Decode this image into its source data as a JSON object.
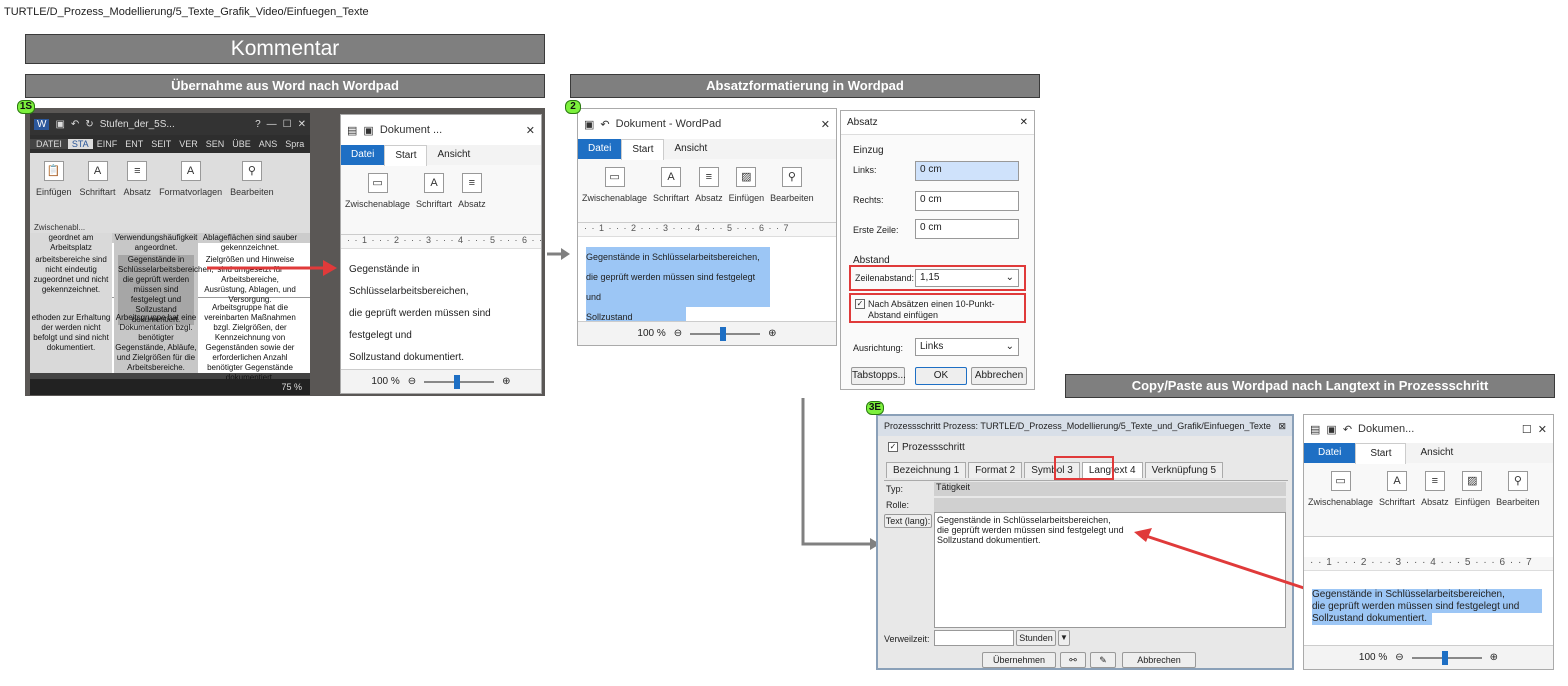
{
  "breadcrumb": "TURTLE/D_Prozess_Modellierung/5_Texte_Grafik_Video/Einfuegen_Texte",
  "headers": {
    "kommentar": "Kommentar",
    "step1": "Übernahme aus Word nach Wordpad",
    "step2": "Absatzformatierung in Wordpad",
    "step3": "Copy/Paste aus Wordpad nach Langtext in Prozessschritt"
  },
  "markers": {
    "m1": "1S",
    "m2": "2",
    "m3": "3E"
  },
  "word": {
    "title": "Stufen_der_5S...",
    "help": "?",
    "tabs": [
      "DATEI",
      "STA",
      "EINF",
      "ENT",
      "SEIT",
      "VER",
      "SEN",
      "ÜBE",
      "ANS",
      "Spra"
    ],
    "groups": [
      "Einfügen",
      "Schriftart",
      "Absatz",
      "Formatvorlagen",
      "Bearbeiten"
    ],
    "group_label": "Zwischenabl...",
    "cells": [
      "geordnet am Arbeitsplatz",
      "Verwendungshäufigkeit angeordnet.",
      "Ablageflächen sind sauber gekennzeichnet.",
      "arbeitsbereiche sind nicht eindeutig zugeordnet und nicht gekennzeichnet.",
      "Gegenstände in Schlüsselarbeitsbereichen, die geprüft werden müssen sind festgelegt und Sollzustand dokumentiert.",
      "Zielgrößen und Hinweise sind umgesetzt für Arbeitsbereiche, Ausrüstung, Ablagen, und Versorgung.",
      "ethoden zur Erhaltung der werden nicht befolgt und sind nicht dokumentiert.",
      "Arbeitsgruppe hat eine Dokumentation bzgl. benötigter Gegenstände, Abläufe, und Zielgrößen für die Arbeitsbereiche.",
      "Arbeitsgruppe hat die vereinbarten Maßnahmen bzgl. Zielgrößen, der Kennzeichnung von Gegenständen sowie der erforderlichen Anzahl benötigter Gegenstände dokumentiert."
    ],
    "zoom": "75 %"
  },
  "wordpad": {
    "title1": "Dokument ...",
    "title2": "Dokument - WordPad",
    "title3": "Dokumen...",
    "tabs": [
      "Datei",
      "Start",
      "Ansicht"
    ],
    "groups": [
      "Zwischenablage",
      "Schriftart",
      "Absatz",
      "Einfügen",
      "Bearbeiten"
    ],
    "ruler": "·  · 1 · · · 2 · · · 3 · · · 4 · · · 5 · · · 6 · · 7",
    "lines": [
      "Gegenstände in Schlüsselarbeitsbereichen,",
      "die geprüft werden müssen sind festgelegt und",
      "Sollzustand dokumentiert."
    ],
    "zoom": "100 %"
  },
  "absatz": {
    "title": "Absatz",
    "einzug": "Einzug",
    "links_label": "Links:",
    "links_value": "0 cm",
    "rechts_label": "Rechts:",
    "rechts_value": "0 cm",
    "erste_label": "Erste Zeile:",
    "erste_value": "0 cm",
    "abstand": "Abstand",
    "zeilen_label": "Zeilenabstand:",
    "zeilen_value": "1,15",
    "nach_label": "Nach Absätzen einen 10-Punkt-Abstand einfügen",
    "ausrichtung_label": "Ausrichtung:",
    "ausrichtung_value": "Links",
    "tabstopps": "Tabstopps...",
    "ok": "OK",
    "abbrechen": "Abbrechen"
  },
  "prozess": {
    "title": "Prozessschritt Prozess: TURTLE/D_Prozess_Modellierung/5_Texte_und_Grafik/Einfuegen_Texte",
    "checkbox": "Prozessschritt",
    "tabs": [
      "Bezeichnung 1",
      "Format 2",
      "Symbol 3",
      "Langtext 4",
      "Verknüpfung 5"
    ],
    "typ_label": "Typ:",
    "typ_value": "Tätigkeit",
    "rolle_label": "Rolle:",
    "text_label": "Text (lang):",
    "text_lines": [
      "Gegenstände in Schlüsselarbeitsbereichen,",
      "die geprüft werden müssen sind festgelegt und",
      "Sollzustand dokumentiert."
    ],
    "verweilzeit_label": "Verweilzeit:",
    "unit": "Stunden",
    "uebernehmen": "Übernehmen",
    "abbrechen": "Abbrechen"
  },
  "colors": {
    "header_bg": "#7f7f7f",
    "accent": "#1e6fc4",
    "highlight": "#e03a3a",
    "selection": "#9cc6f5"
  }
}
